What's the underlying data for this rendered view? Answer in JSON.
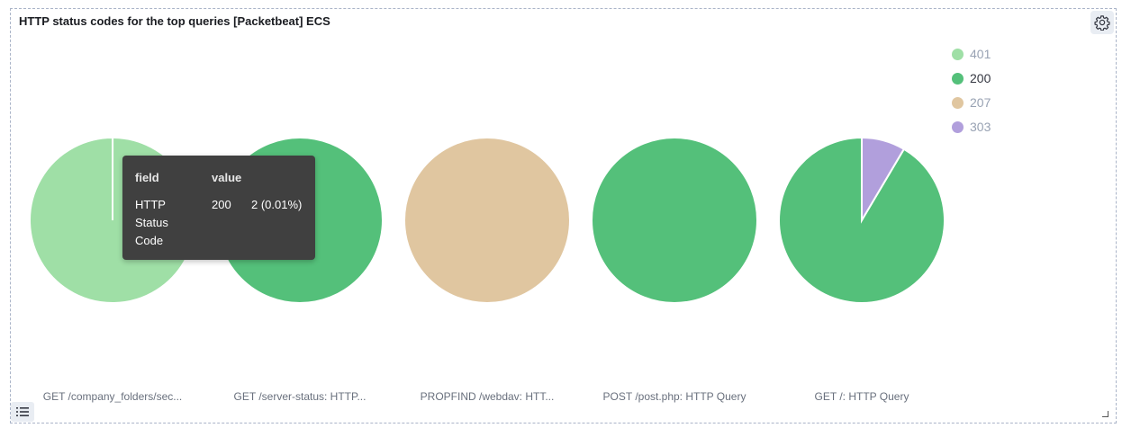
{
  "panel": {
    "title": "HTTP status codes for the top queries [Packetbeat] ECS",
    "settings_icon": "gear-icon",
    "legend_toggle_icon": "list-icon"
  },
  "legend": {
    "items": [
      {
        "label": "401",
        "color": "#9fdfa6",
        "active": false
      },
      {
        "label": "200",
        "color": "#54c07a",
        "active": true
      },
      {
        "label": "207",
        "color": "#e0c6a0",
        "active": false
      },
      {
        "label": "303",
        "color": "#b19fdc",
        "active": false
      }
    ]
  },
  "tooltip": {
    "header_field": "field",
    "header_value": "value",
    "field": "HTTP Status Code",
    "value": "200",
    "extra": "2 (0.01%)"
  },
  "chart_data": {
    "type": "pie",
    "title": "HTTP status codes for the top queries [Packetbeat] ECS",
    "legend": [
      "401",
      "200",
      "207",
      "303"
    ],
    "legend_position": "top-right",
    "pies": [
      {
        "label": "GET /company_folders/sec...",
        "slices": [
          {
            "name": "401",
            "value": 99.99
          },
          {
            "name": "200",
            "value": 0.01
          }
        ]
      },
      {
        "label": "GET /server-status: HTTP...",
        "slices": [
          {
            "name": "200",
            "value": 100
          }
        ]
      },
      {
        "label": "PROPFIND /webdav: HTT...",
        "slices": [
          {
            "name": "207",
            "value": 100
          }
        ]
      },
      {
        "label": "POST /post.php: HTTP Query",
        "slices": [
          {
            "name": "200",
            "value": 100
          }
        ]
      },
      {
        "label": "GET /: HTTP Query",
        "slices": [
          {
            "name": "200",
            "value": 91.5
          },
          {
            "name": "303",
            "value": 8.5
          }
        ]
      }
    ]
  }
}
